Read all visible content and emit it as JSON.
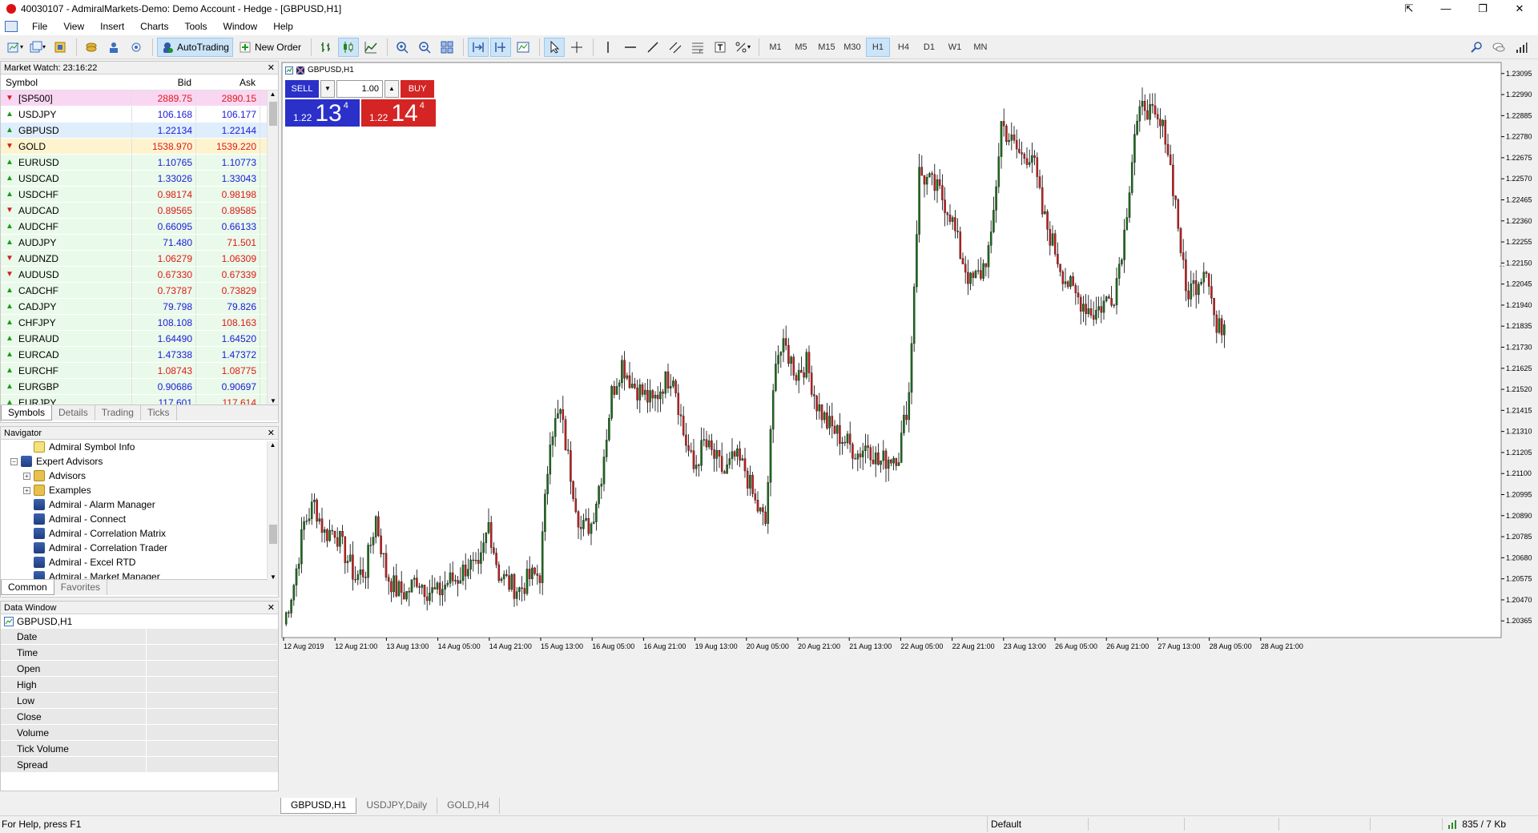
{
  "window": {
    "title": "40030107 - AdmiralMarkets-Demo: Demo Account - Hedge - [GBPUSD,H1]",
    "controls": [
      "⇱",
      "—",
      "❐",
      "✕"
    ]
  },
  "menu": [
    "File",
    "View",
    "Insert",
    "Charts",
    "Tools",
    "Window",
    "Help"
  ],
  "toolbar": {
    "autotrading_label": "AutoTrading",
    "new_order_label": "New Order",
    "timeframes": [
      "M1",
      "M5",
      "M15",
      "M30",
      "H1",
      "H4",
      "D1",
      "W1",
      "MN"
    ],
    "active_timeframe": "H1"
  },
  "market_watch": {
    "title": "Market Watch: 23:16:22",
    "col_symbol": "Symbol",
    "col_bid": "Bid",
    "col_ask": "Ask",
    "rows": [
      {
        "symbol": "[SP500]",
        "bid": "2889.75",
        "ask": "2890.15",
        "dir": "down",
        "bg": "#f9d7f3",
        "color": "red"
      },
      {
        "symbol": "USDJPY",
        "bid": "106.168",
        "ask": "106.177",
        "dir": "up",
        "bg": "#ffffff",
        "color": "blue"
      },
      {
        "symbol": "GBPUSD",
        "bid": "1.22134",
        "ask": "1.22144",
        "dir": "up",
        "bg": "#dfeefc",
        "color": "blue"
      },
      {
        "symbol": "GOLD",
        "bid": "1538.970",
        "ask": "1539.220",
        "dir": "down",
        "bg": "#fdf4cf",
        "color": "red"
      },
      {
        "symbol": "EURUSD",
        "bid": "1.10765",
        "ask": "1.10773",
        "dir": "up",
        "bg": "#eafaea",
        "color": "blue"
      },
      {
        "symbol": "USDCAD",
        "bid": "1.33026",
        "ask": "1.33043",
        "dir": "up",
        "bg": "#eafaea",
        "color": "blue"
      },
      {
        "symbol": "USDCHF",
        "bid": "0.98174",
        "ask": "0.98198",
        "dir": "up",
        "bg": "#eafaea",
        "color": "red"
      },
      {
        "symbol": "AUDCAD",
        "bid": "0.89565",
        "ask": "0.89585",
        "dir": "down",
        "bg": "#eafaea",
        "color": "red"
      },
      {
        "symbol": "AUDCHF",
        "bid": "0.66095",
        "ask": "0.66133",
        "dir": "up",
        "bg": "#eafaea",
        "color": "blue"
      },
      {
        "symbol": "AUDJPY",
        "bid": "71.480",
        "ask": "71.501",
        "dir": "up",
        "bg": "#eafaea",
        "color": "blue-red"
      },
      {
        "symbol": "AUDNZD",
        "bid": "1.06279",
        "ask": "1.06309",
        "dir": "down",
        "bg": "#eafaea",
        "color": "red"
      },
      {
        "symbol": "AUDUSD",
        "bid": "0.67330",
        "ask": "0.67339",
        "dir": "down",
        "bg": "#eafaea",
        "color": "red"
      },
      {
        "symbol": "CADCHF",
        "bid": "0.73787",
        "ask": "0.73829",
        "dir": "up",
        "bg": "#eafaea",
        "color": "red"
      },
      {
        "symbol": "CADJPY",
        "bid": "79.798",
        "ask": "79.826",
        "dir": "up",
        "bg": "#eafaea",
        "color": "blue"
      },
      {
        "symbol": "CHFJPY",
        "bid": "108.108",
        "ask": "108.163",
        "dir": "up",
        "bg": "#eafaea",
        "color": "blue-red"
      },
      {
        "symbol": "EURAUD",
        "bid": "1.64490",
        "ask": "1.64520",
        "dir": "up",
        "bg": "#eafaea",
        "color": "blue"
      },
      {
        "symbol": "EURCAD",
        "bid": "1.47338",
        "ask": "1.47372",
        "dir": "up",
        "bg": "#eafaea",
        "color": "blue"
      },
      {
        "symbol": "EURCHF",
        "bid": "1.08743",
        "ask": "1.08775",
        "dir": "up",
        "bg": "#eafaea",
        "color": "red"
      },
      {
        "symbol": "EURGBP",
        "bid": "0.90686",
        "ask": "0.90697",
        "dir": "up",
        "bg": "#eafaea",
        "color": "blue"
      },
      {
        "symbol": "EURJPY",
        "bid": "117.601",
        "ask": "117.614",
        "dir": "up",
        "bg": "#eafaea",
        "color": "blue-red"
      }
    ],
    "tabs": [
      "Symbols",
      "Details",
      "Trading",
      "Ticks"
    ],
    "active_tab": "Symbols"
  },
  "navigator": {
    "title": "Navigator",
    "items": [
      {
        "label": "Admiral Symbol Info",
        "level": 2,
        "icon": "script",
        "expander": ""
      },
      {
        "label": "Expert Advisors",
        "level": 1,
        "icon": "ea",
        "expander": "⊟"
      },
      {
        "label": "Advisors",
        "level": 2,
        "icon": "folder",
        "expander": "⊞"
      },
      {
        "label": "Examples",
        "level": 2,
        "icon": "folder",
        "expander": "⊞"
      },
      {
        "label": "Admiral - Alarm Manager",
        "level": 2,
        "icon": "ea",
        "expander": ""
      },
      {
        "label": "Admiral - Connect",
        "level": 2,
        "icon": "ea",
        "expander": ""
      },
      {
        "label": "Admiral - Correlation Matrix",
        "level": 2,
        "icon": "ea",
        "expander": ""
      },
      {
        "label": "Admiral - Correlation Trader",
        "level": 2,
        "icon": "ea",
        "expander": ""
      },
      {
        "label": "Admiral - Excel RTD",
        "level": 2,
        "icon": "ea",
        "expander": ""
      },
      {
        "label": "Admiral - Market Manager",
        "level": 2,
        "icon": "ea",
        "expander": ""
      }
    ],
    "tabs": [
      "Common",
      "Favorites"
    ],
    "active_tab": "Common"
  },
  "data_window": {
    "title": "Data Window",
    "symbol": "GBPUSD,H1",
    "fields": [
      "Date",
      "Time",
      "Open",
      "High",
      "Low",
      "Close",
      "Volume",
      "Tick Volume",
      "Spread"
    ]
  },
  "one_click": {
    "sell_label": "SELL",
    "buy_label": "BUY",
    "lot": "1.00",
    "sell_small": "1.22",
    "sell_big": "13",
    "sell_sup": "4",
    "buy_small": "1.22",
    "buy_big": "14",
    "buy_sup": "4"
  },
  "chart_tabs": [
    "GBPUSD,H1",
    "USDJPY,Daily",
    "GOLD,H4"
  ],
  "active_chart_tab": "GBPUSD,H1",
  "status": {
    "help": "For Help, press F1",
    "profile": "Default",
    "connection": "835 / 7 Kb"
  },
  "chart_data": {
    "type": "candlestick",
    "symbol_label": "GBPUSD,H1",
    "bull_color": "#1c6b1c",
    "bear_color": "#c41e1e",
    "y_ticks": [
      "1.23095",
      "1.22990",
      "1.22885",
      "1.22780",
      "1.22675",
      "1.22570",
      "1.22465",
      "1.22360",
      "1.22255",
      "1.22150",
      "1.22045",
      "1.21940",
      "1.21835",
      "1.21730",
      "1.21625",
      "1.21520",
      "1.21415",
      "1.21310",
      "1.21205",
      "1.21100",
      "1.20995",
      "1.20890",
      "1.20785",
      "1.20680",
      "1.20575",
      "1.20470",
      "1.20365"
    ],
    "ylim": [
      1.2029,
      1.2315
    ],
    "x_ticks": [
      "12 Aug 2019",
      "12 Aug 21:00",
      "13 Aug 13:00",
      "14 Aug 05:00",
      "14 Aug 21:00",
      "15 Aug 13:00",
      "16 Aug 05:00",
      "16 Aug 21:00",
      "19 Aug 13:00",
      "20 Aug 05:00",
      "20 Aug 21:00",
      "21 Aug 13:00",
      "22 Aug 05:00",
      "22 Aug 21:00",
      "23 Aug 13:00",
      "26 Aug 05:00",
      "26 Aug 21:00",
      "27 Aug 13:00",
      "28 Aug 05:00",
      "28 Aug 21:00"
    ],
    "close_path": [
      1.2035,
      1.2055,
      1.2085,
      1.2095,
      1.208,
      1.2082,
      1.207,
      1.2058,
      1.2062,
      1.2088,
      1.206,
      1.2052,
      1.205,
      1.2058,
      1.2052,
      1.205,
      1.2056,
      1.2058,
      1.2065,
      1.206,
      1.2085,
      1.206,
      1.2055,
      1.2052,
      1.2058,
      1.206,
      1.213,
      1.214,
      1.211,
      1.2082,
      1.2085,
      1.211,
      1.215,
      1.2165,
      1.2155,
      1.215,
      1.2145,
      1.2155,
      1.216,
      1.213,
      1.2112,
      1.2125,
      1.2118,
      1.211,
      1.2118,
      1.2112,
      1.2095,
      1.2085,
      1.217,
      1.2172,
      1.216,
      1.2165,
      1.2145,
      1.2135,
      1.213,
      1.2125,
      1.212,
      1.2125,
      1.2115,
      1.2118,
      1.212,
      1.215,
      1.226,
      1.2255,
      1.225,
      1.224,
      1.222,
      1.2205,
      1.221,
      1.2225,
      1.2285,
      1.2275,
      1.2268,
      1.227,
      1.224,
      1.2225,
      1.221,
      1.22,
      1.2195,
      1.219,
      1.2195,
      1.22,
      1.223,
      1.228,
      1.2295,
      1.2285,
      1.228,
      1.2245,
      1.22,
      1.2205,
      1.2215,
      1.218,
      1.2188
    ]
  }
}
